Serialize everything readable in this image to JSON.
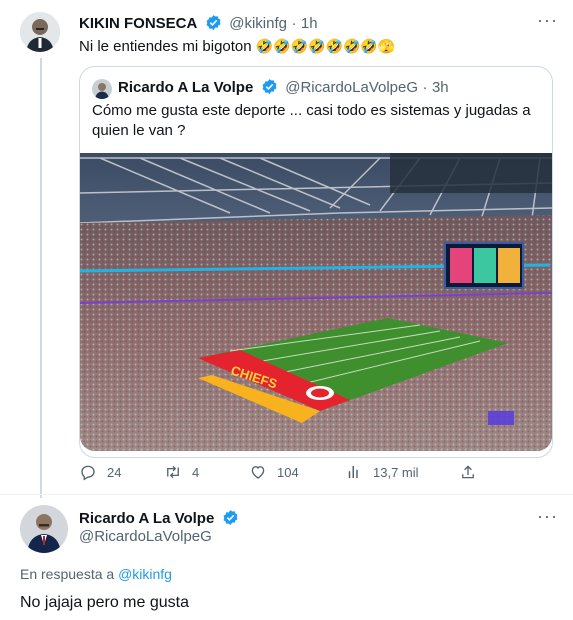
{
  "tweet": {
    "author_name": "KIKIN FONSECA",
    "author_handle": "@kikinfg",
    "separator": "·",
    "time": "1h",
    "text": "Ni le entiendes mi bigoton",
    "emoji": "🤣🤣🤣🤣🤣🤣🤣🫣",
    "more": "···"
  },
  "quoted": {
    "author_name": "Ricardo A La Volpe",
    "author_handle": "@RicardoLaVolpeG",
    "separator": "·",
    "time": "3h",
    "text_line1": "Cómo me gusta este deporte ... casi todo es sistemas y jugadas a",
    "text_line2": "quien le van ?",
    "field_text": "CHIEFS"
  },
  "actions": {
    "replies": "24",
    "retweets": "4",
    "likes": "104",
    "views": "13,7 mil"
  },
  "reply": {
    "author_name": "Ricardo A La Volpe",
    "author_handle": "@RicardoLaVolpeG",
    "more": "···",
    "in_reply_prefix": "En respuesta a",
    "in_reply_handle": "@kikinfg",
    "text": "No jajaja pero me gusta"
  },
  "colors": {
    "accent": "#1d9bf0",
    "muted": "#536471",
    "border": "#cfd9de"
  }
}
